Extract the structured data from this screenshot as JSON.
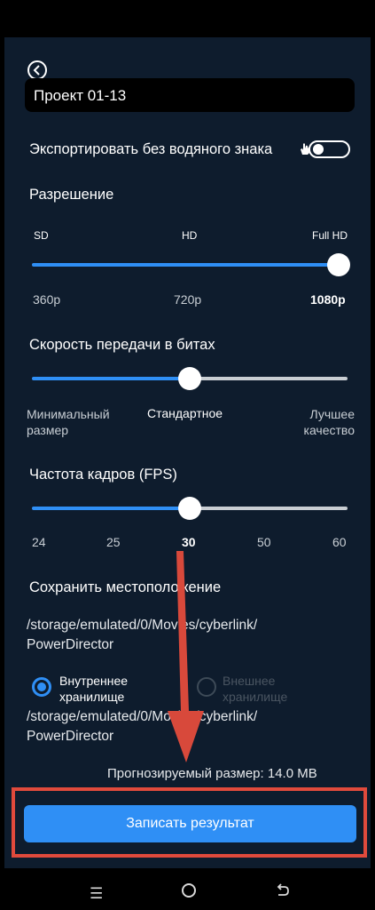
{
  "header": {
    "back_icon": "chevron-left-icon",
    "project_name": "Проект 01-13"
  },
  "watermark": {
    "label": "Экспортировать без водяного знака",
    "enabled": false
  },
  "resolution": {
    "title": "Разрешение",
    "top_labels": [
      "SD",
      "HD",
      "Full HD"
    ],
    "bottom_labels": [
      "360p",
      "720p",
      "1080p"
    ],
    "selected": "1080p"
  },
  "bitrate": {
    "title": "Скорость передачи в битах",
    "left_label": "Минимальный размер",
    "left_line1": "Минимальный",
    "left_line2": "размер",
    "center_label": "Стандартное",
    "right_line1": "Лучшее",
    "right_line2": "качество",
    "selected": "Стандартное"
  },
  "fps": {
    "title": "Частота кадров (FPS)",
    "ticks": [
      "24",
      "25",
      "30",
      "50",
      "60"
    ],
    "selected": "30"
  },
  "save_location": {
    "title": "Сохранить местоположение",
    "path_line1": "/storage/emulated/0/Movies/cyberlink/",
    "path_line2": "PowerDirector",
    "internal_line1": "Внутреннее",
    "internal_line2": "хранилище",
    "external_line1": "Внешнее",
    "external_line2": "хранилище",
    "selected": "internal",
    "path2_line1": "/storage/emulated/0/Movies/cyberlink/",
    "path2_line2": "PowerDirector"
  },
  "estimated_size": "Прогнозируемый размер: 14.0 MB",
  "action_button": "Записать результат",
  "colors": {
    "accent": "#2f8ff5",
    "panel": "#0e1c2d",
    "highlight": "#e04a3c"
  },
  "navbar": {
    "icons": [
      "menu-icon",
      "home-icon",
      "back-icon"
    ]
  }
}
